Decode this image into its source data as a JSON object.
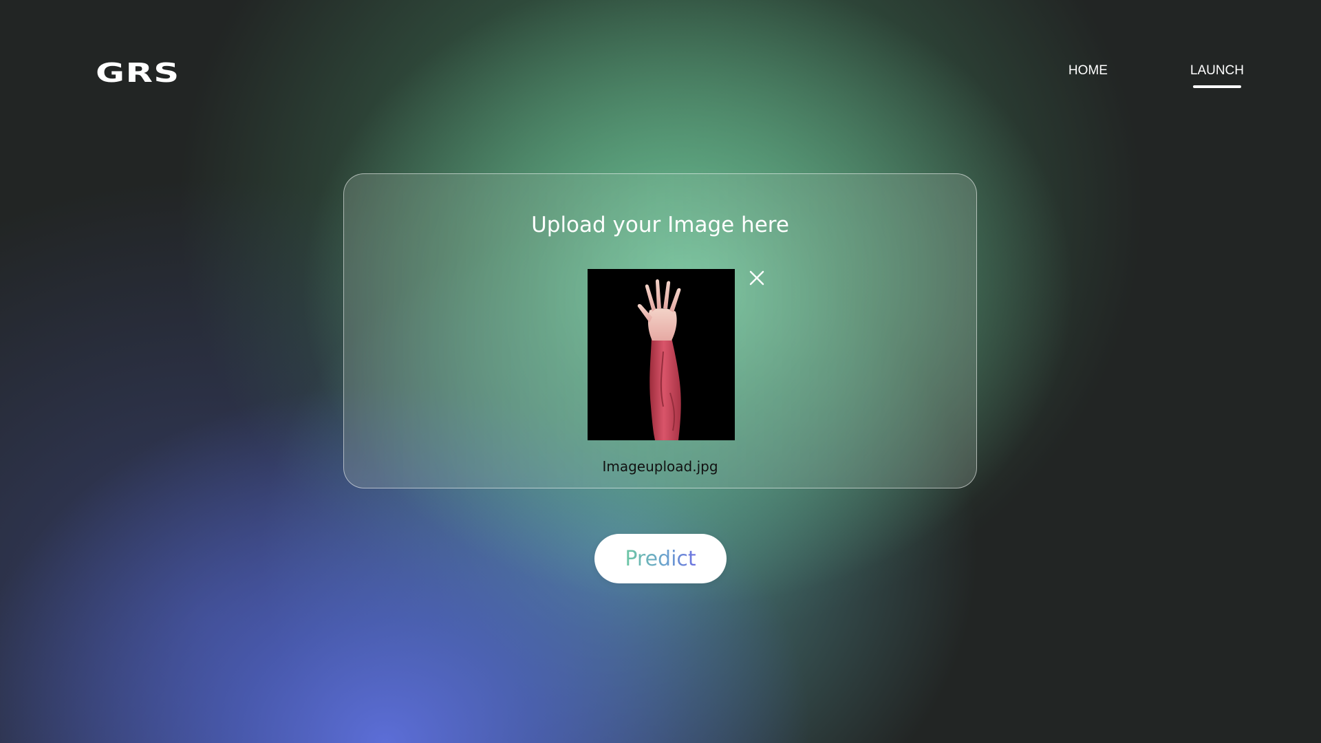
{
  "header": {
    "logo": "GRS",
    "nav": {
      "home_label": "HOME",
      "launch_label": "LAUNCH",
      "active": "LAUNCH"
    }
  },
  "upload": {
    "title": "Upload your Image here",
    "file_name": "Imageupload.jpg",
    "preview_image": "arm-raised-hand-photo",
    "remove_icon": "close-icon"
  },
  "actions": {
    "predict_label": "Predict"
  },
  "colors": {
    "background_dark": "#222524",
    "accent_green": "#78c8a0",
    "accent_blue": "#5c6ed7",
    "button_bg": "#ffffff",
    "text_light": "#ffffff",
    "text_dark": "#111111"
  }
}
